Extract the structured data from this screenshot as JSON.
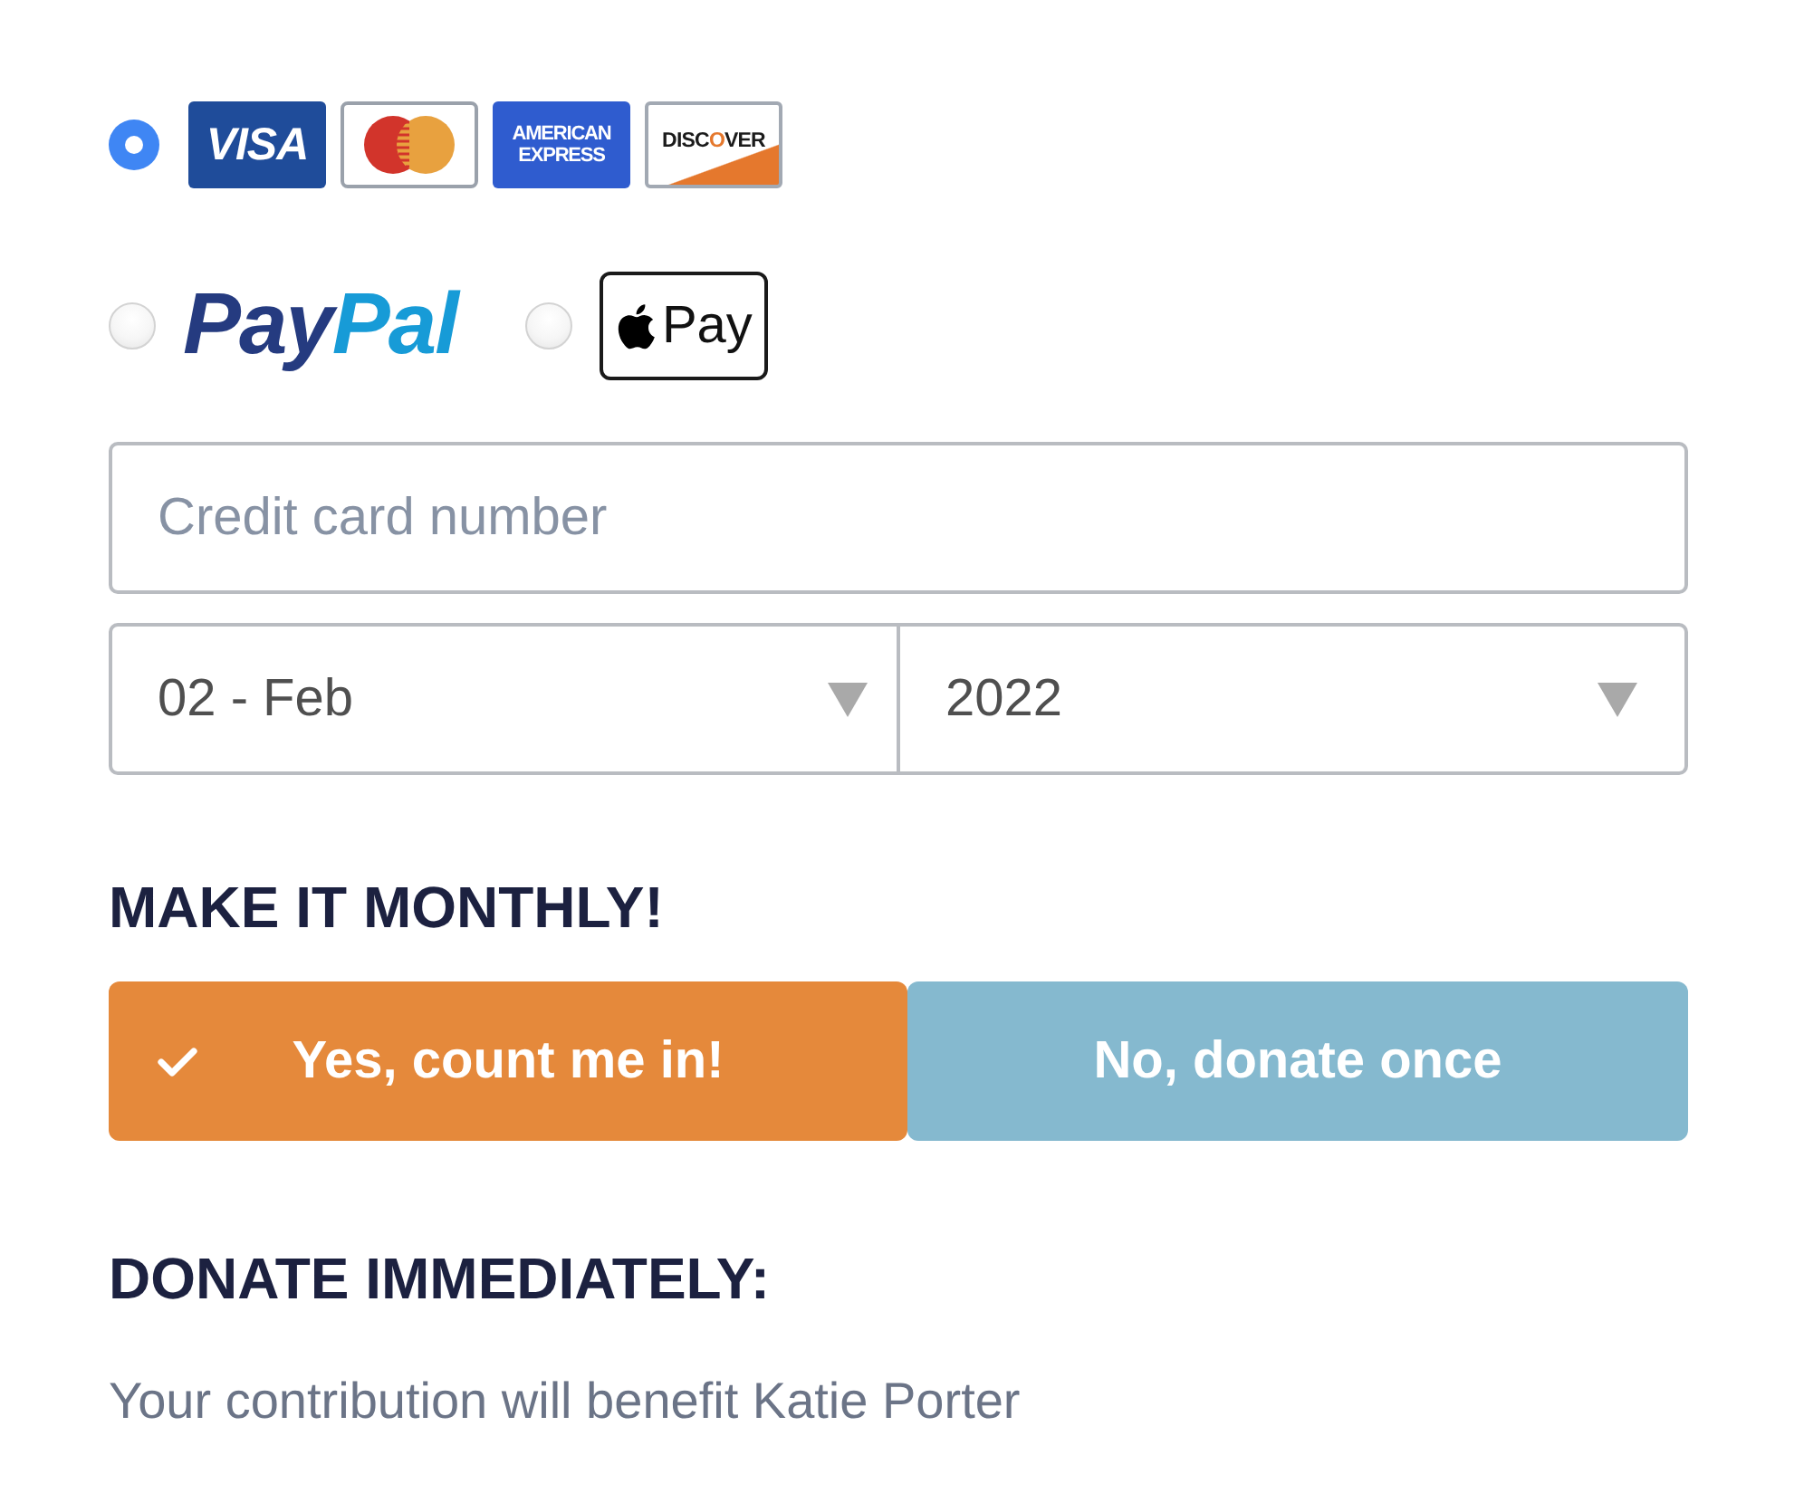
{
  "payment_rows": [
    {
      "methods": [
        {
          "kind": "cards",
          "selected": true,
          "cards": [
            {
              "kind": "visa",
              "text": "VISA"
            },
            {
              "kind": "mastercard"
            },
            {
              "kind": "amex",
              "lines": [
                "AMERICAN",
                "EXPRESS"
              ]
            },
            {
              "kind": "discover",
              "parts": [
                "DISC",
                "O",
                "VER"
              ]
            }
          ]
        }
      ]
    },
    {
      "methods": [
        {
          "kind": "paypal",
          "selected": false,
          "parts": [
            "Pay",
            "Pal"
          ]
        },
        {
          "kind": "applepay",
          "selected": false,
          "text": "Pay"
        }
      ]
    }
  ],
  "card_number": {
    "placeholder": "Credit card number"
  },
  "expiry": [
    {
      "value": "02 - Feb"
    },
    {
      "value": "2022"
    }
  ],
  "monthly": {
    "heading": "MAKE IT MONTHLY!",
    "options": [
      {
        "label": "Yes, count me in!",
        "selected": true
      },
      {
        "label": "No, donate once",
        "selected": false
      }
    ]
  },
  "donate": {
    "heading": "DONATE IMMEDIATELY:",
    "note": "Your contribution will benefit Katie Porter"
  }
}
